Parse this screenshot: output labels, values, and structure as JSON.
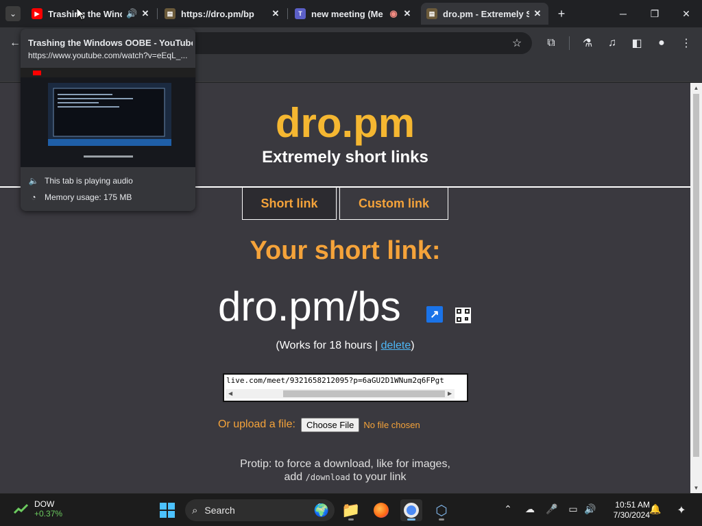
{
  "browser": {
    "tabs": [
      {
        "title": "Trashing the Windows OOBE - YouTube",
        "short": "Trashing the Wind",
        "favicon": "youtube-icon",
        "audio": true
      },
      {
        "title": "https://dro.pm/bp",
        "short": "https://dro.pm/bp",
        "favicon": "dropm-icon"
      },
      {
        "title": "new meeting (Meeting)",
        "short": "new meeting (Me",
        "favicon": "teams-icon",
        "recording": true
      },
      {
        "title": "dro.pm - Extremely Short Links",
        "short": "dro.pm - Extremely Sh",
        "favicon": "dropm-icon",
        "active": true
      }
    ],
    "close_glyph": "✕",
    "new_tab_glyph": "+"
  },
  "hovercard": {
    "title": "Trashing the Windows OOBE - YouTube",
    "url": "https://www.youtube.com/watch?v=eEqL_...",
    "audio_label": "This tab is playing audio",
    "memory_label": "Memory usage: 175 MB"
  },
  "page": {
    "logo": "dro.pm",
    "tagline": "Extremely short links",
    "mode_tabs": [
      "Short link",
      "Custom link"
    ],
    "result_heading": "Your short link:",
    "short_link": "dro.pm/bs",
    "works_prefix": "(Works for 18 hours | ",
    "delete_label": "delete",
    "works_suffix": ")",
    "url_value": "live.com/meet/9321658212095?p=6aGU2D1WNum2q6FPgt",
    "upload_label": "Or upload a file:",
    "choose_file": "Choose File",
    "no_file": "No file chosen",
    "protip_line1": "Protip: to force a download, like for images,",
    "protip_add": "add ",
    "protip_code": "/download",
    "protip_end": " to your link"
  },
  "taskbar": {
    "stock_name": "DOW",
    "stock_change": "+0.37%",
    "search_label": "Search",
    "time": "10:51 AM",
    "date": "7/30/2024"
  },
  "colors": {
    "accent_orange": "#f5a33a",
    "logo_yellow": "#f5b731",
    "page_bg": "#3a393f",
    "link_blue": "#4db6f5"
  }
}
